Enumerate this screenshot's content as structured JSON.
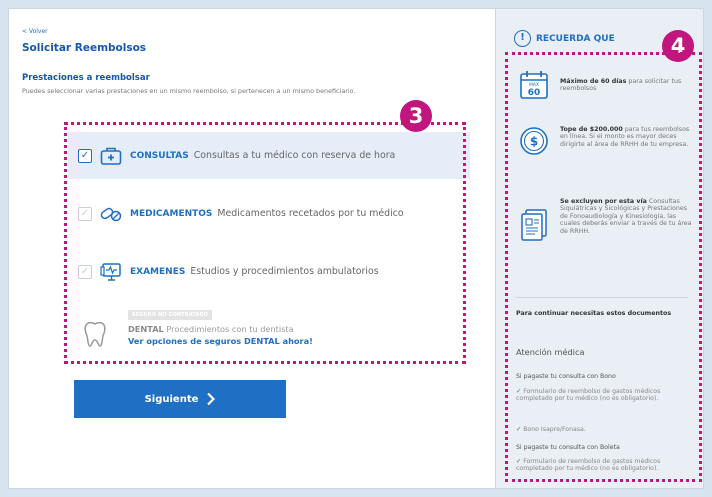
{
  "back_label": "< Volver",
  "page_title": "Solicitar Reembolsos",
  "section_title": "Prestaciones a reembolsar",
  "section_helper": "Puedes seleccionar varias prestaciones en un mismo reembolso, si pertenecen a un mismo beneficiario.",
  "annotations": {
    "badge_left": "3",
    "badge_right": "4"
  },
  "options": [
    {
      "label": "CONSULTAS",
      "description": "Consultas a tu médico con reserva de hora",
      "checked": true,
      "icon": "medical-kit-icon"
    },
    {
      "label": "MEDICAMENTOS",
      "description": "Medicamentos recetados por tu médico",
      "checked": false,
      "icon": "pills-icon"
    },
    {
      "label": "EXAMENES",
      "description": "Estudios y procedimientos ambulatorios",
      "checked": false,
      "icon": "monitor-icon"
    }
  ],
  "dental": {
    "tag": "SEGURO NO CONTRATADO",
    "label": "DENTAL",
    "description": "Procedimientos con tu dentista",
    "link": "Ver opciones de seguros DENTAL ahora!",
    "icon": "tooth-icon"
  },
  "next_button": {
    "label": "Siguiente",
    "icon": "chevron-right-icon"
  },
  "sidebar": {
    "title": "RECUERDA QUE",
    "title_icon": "exclamation-icon",
    "info": [
      {
        "bold": "Máximo de 60 días",
        "text": "para solicitar tus reembolsos",
        "icon": "calendar-icon",
        "calendar_month": "MAX",
        "calendar_day": "60"
      },
      {
        "bold": "Tope de $200.000",
        "text": "para tus reembolsos en línea. Si el monto es mayor deces dirigirte al área de RRHH de tu empresa.",
        "icon": "dollar-coin-icon",
        "coin_symbol": "$"
      },
      {
        "bold": "Se excluyen por esta vía",
        "text": "Consultas Siquiátricas y Sicológicas y Prestaciones de Fonoaudiología y Kinesiología, las cuales deberás enviar a través de tu área de RRHH.",
        "icon": "document-icon"
      }
    ],
    "docs_heading": "Para continuar necesitas estos documentos",
    "docs_subheading": "Atención médica",
    "case1_title": "Si pagaste tu consulta con Bono",
    "case1_items": [
      "Formulario de reembolso de gastos médicos completado por tu médico (no es obligatorio).",
      "Bono Isapre/Fonasa."
    ],
    "case2_title": "Si pagaste tu consulta con Boleta",
    "case2_items": [
      "Formulario de reembolso de gastos médicos completado por tu médico (no es obligatorio)."
    ],
    "check_mark": "✓"
  },
  "colors": {
    "accent": "#1f6fc4",
    "annotation": "#c0167d",
    "selected_row": "#e5eef8",
    "sidebar_bg": "#e9eff5"
  }
}
